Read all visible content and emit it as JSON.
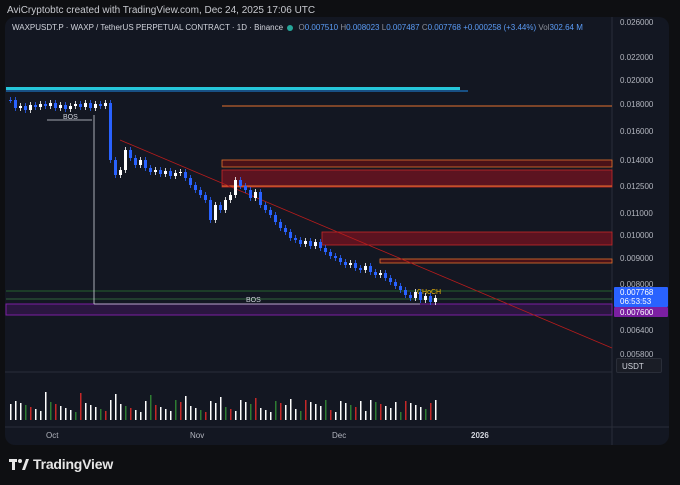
{
  "header": {
    "creator_text": "AviCryptobtc created with TradingView.com, Dec 24, 2025 17:06 UTC"
  },
  "legend": {
    "symbol": "WAXPUSDT.P · WAXP / TetherUS PERPETUAL CONTRACT · 1D · Binance",
    "o_label": "O",
    "o_value": "0.007510",
    "h_label": "H",
    "h_value": "0.008023",
    "l_label": "L",
    "l_value": "0.007487",
    "c_label": "C",
    "c_value": "0.007768",
    "change": "+0.000258 (+3.44%)",
    "vol_label": "Vol",
    "vol_value": "302.64 M"
  },
  "price_axis": {
    "ticks": [
      "0.026000",
      "0.022000",
      "0.020000",
      "0.018000",
      "0.016000",
      "0.014000",
      "0.012500",
      "0.011000",
      "0.010000",
      "0.009000",
      "0.008000",
      "0.006400",
      "0.005800"
    ],
    "current_price": "0.007768",
    "countdown": "06:53:53",
    "support_price": "0.007600"
  },
  "time_axis": {
    "ticks": [
      "Oct",
      "Nov",
      "Dec",
      "2026"
    ]
  },
  "annotations": {
    "bos_top": "BOS",
    "bos_bottom": "BOS",
    "choch": "CHoCH"
  },
  "currency_badge": "USDT",
  "brand": "TradingView",
  "colors": {
    "up": "#ffffff",
    "down": "#2962ff",
    "resistance": "#b71c1c",
    "support_band": "#6a1b9a",
    "teal_line": "#26c6da"
  }
}
